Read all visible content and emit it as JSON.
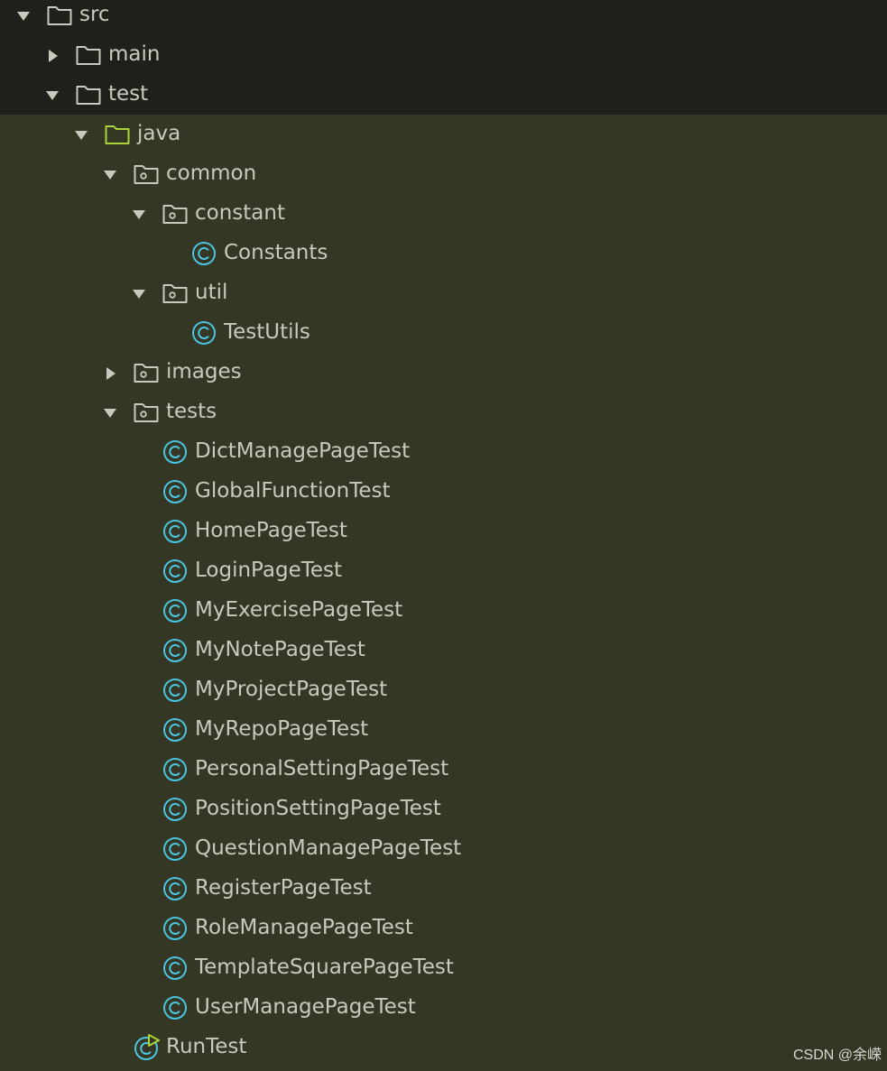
{
  "colors": {
    "header_background": "#1f201b",
    "tree_background": "#333723",
    "text": "#c9cabd",
    "folder_icon": "#c9cabd",
    "source_folder_icon": "#a8d43a",
    "class_icon": "#4cc4e0",
    "run_marker": "#a8d43a"
  },
  "tree": {
    "src": {
      "label": "src",
      "expanded": true,
      "icon": "folder-icon"
    },
    "main": {
      "label": "main",
      "expanded": false,
      "icon": "folder-icon"
    },
    "test": {
      "label": "test",
      "expanded": true,
      "icon": "folder-icon"
    },
    "java": {
      "label": "java",
      "expanded": true,
      "icon": "source-root-folder-icon"
    },
    "common": {
      "label": "common",
      "expanded": true,
      "icon": "package-icon"
    },
    "constant": {
      "label": "constant",
      "expanded": true,
      "icon": "package-icon"
    },
    "constants_class": {
      "label": "Constants",
      "icon": "class-icon"
    },
    "util": {
      "label": "util",
      "expanded": true,
      "icon": "package-icon"
    },
    "testutils_class": {
      "label": "TestUtils",
      "icon": "class-icon"
    },
    "images": {
      "label": "images",
      "expanded": false,
      "icon": "package-icon"
    },
    "tests": {
      "label": "tests",
      "expanded": true,
      "icon": "package-icon",
      "classes": [
        "DictManagePageTest",
        "GlobalFunctionTest",
        "HomePageTest",
        "LoginPageTest",
        "MyExercisePageTest",
        "MyNotePageTest",
        "MyProjectPageTest",
        "MyRepoPageTest",
        "PersonalSettingPageTest",
        "PositionSettingPageTest",
        "QuestionManagePageTest",
        "RegisterPageTest",
        "RoleManagePageTest",
        "TemplateSquarePageTest",
        "UserManagePageTest"
      ]
    },
    "runtest_class": {
      "label": "RunTest",
      "icon": "runnable-class-icon"
    }
  },
  "watermark": "CSDN @余嵘"
}
